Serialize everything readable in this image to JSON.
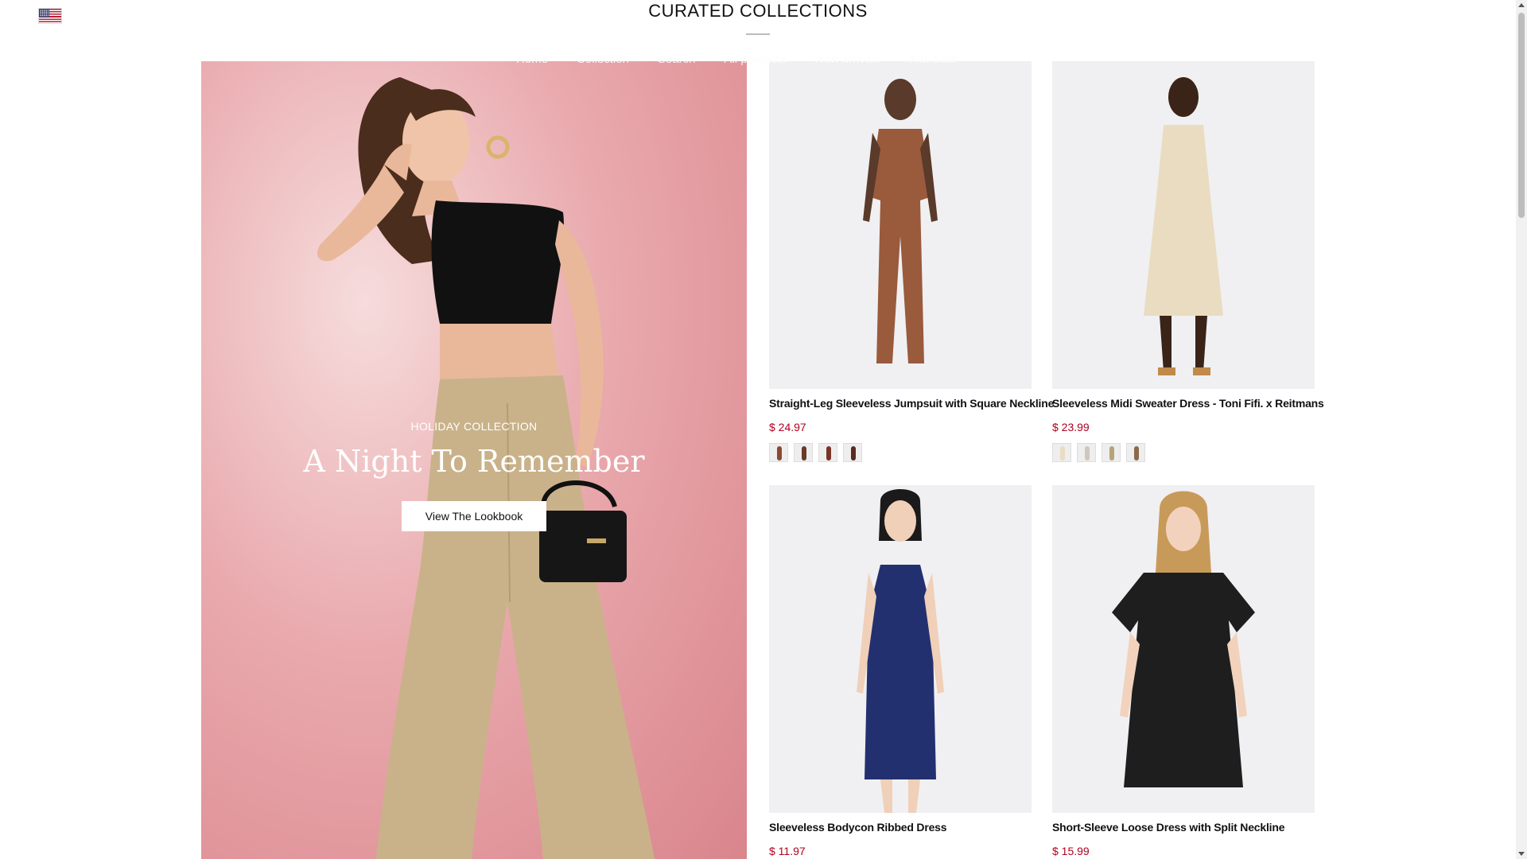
{
  "header": {
    "title": "CURATED COLLECTIONS",
    "flag_icon": "us-flag-icon"
  },
  "nav": {
    "items": [
      "Home",
      "Collection",
      "Search",
      "All products",
      "New arrivals",
      "Flat Sale"
    ]
  },
  "hero": {
    "eyebrow": "HOLIDAY COLLECTION",
    "title": "A Night To Remember",
    "button": "View The Lookbook"
  },
  "products": [
    {
      "title": "Straight-Leg Sleeveless Jumpsuit with Square Neckline",
      "price": "$ 24.97",
      "garment_color": "#9a5a3c",
      "swatch_colors": [
        "#8a4a30",
        "#6b3a28",
        "#7a3426",
        "#5a2c1e"
      ]
    },
    {
      "title": "Sleeveless Midi Sweater Dress - Toni Fifi. x Reitmans",
      "price": "$ 23.99",
      "garment_color": "#eadcc0",
      "swatch_colors": [
        "#e8dcc4",
        "#cfc7b8",
        "#b8a27a",
        "#8a6a4a"
      ]
    },
    {
      "title": "Sleeveless Bodycon Ribbed Dress",
      "price": "$ 11.97",
      "garment_color": "#233070",
      "swatch_colors": []
    },
    {
      "title": "Short-Sleeve Loose Dress with Split Neckline",
      "price": "$ 15.99",
      "garment_color": "#1e1e1e",
      "swatch_colors": []
    }
  ],
  "colors": {
    "price": "#b0001e",
    "hero_background": "#d9858c"
  }
}
